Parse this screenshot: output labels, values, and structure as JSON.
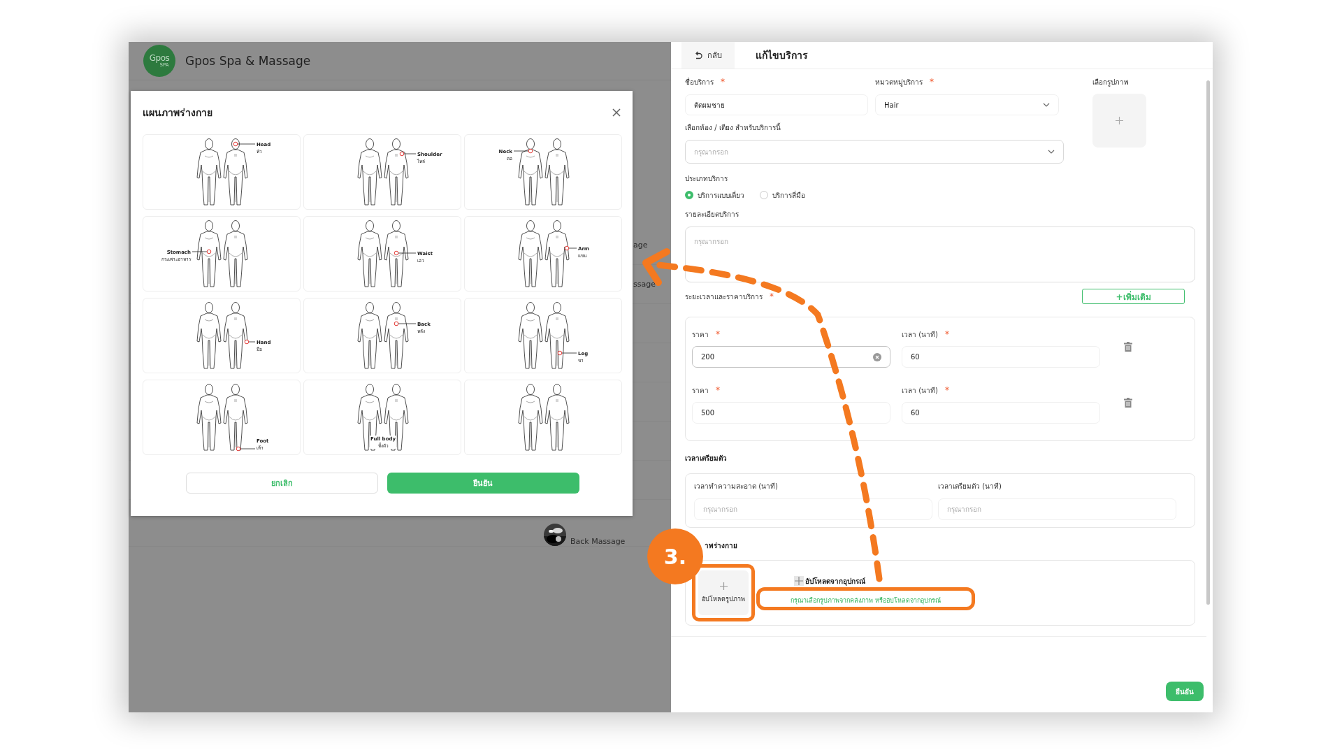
{
  "app": {
    "logo": {
      "text": "Gpos",
      "subtext": "SPA"
    },
    "title": "Gpos Spa & Massage",
    "list_items": [
      {
        "text": "age",
        "kind": "plain"
      },
      {
        "text": "ssage",
        "kind": "plain"
      },
      {
        "kind": "empty"
      },
      {
        "kind": "empty"
      },
      {
        "kind": "empty"
      },
      {
        "kind": "empty"
      },
      {
        "kind": "empty"
      },
      {
        "text": "Back Massage",
        "kind": "picture"
      }
    ]
  },
  "body_map_dialog": {
    "title": "แผนภาพร่างกาย",
    "cards": [
      {
        "kind": "head",
        "label": "Head",
        "label_th": "หัว"
      },
      {
        "kind": "shoulder",
        "label": "Shoulder",
        "label_th": "ไหล่"
      },
      {
        "kind": "neck",
        "label": "Neck",
        "label_th": "คอ"
      },
      {
        "kind": "stomach",
        "label": "Stomach",
        "label_th": "กระเพาะอาหาร"
      },
      {
        "kind": "waist",
        "label": "Waist",
        "label_th": "เอว"
      },
      {
        "kind": "arm",
        "label": "Arm",
        "label_th": "แขน"
      },
      {
        "kind": "hand",
        "label": "Hand",
        "label_th": "มือ"
      },
      {
        "kind": "back",
        "label": "Back",
        "label_th": "หลัง"
      },
      {
        "kind": "leg",
        "label": "Leg",
        "label_th": "ขา"
      },
      {
        "kind": "foot",
        "label": "Foot",
        "label_th": "เท้า"
      },
      {
        "kind": "full",
        "label": "Full body",
        "label_th": "ทั้งตัว"
      },
      {
        "kind": "none"
      }
    ],
    "cancel_button": "ยกเลิก",
    "confirm_button": "ยืนยัน"
  },
  "edit_panel": {
    "back_button": "กลับ",
    "title": "แก้ไขบริการ",
    "service_name": {
      "label": "ชื่อบริการ",
      "required_mark": "*",
      "value": "ตัดผมชาย"
    },
    "category": {
      "label": "หมวดหมู่บริการ",
      "required_mark": "*",
      "value": "Hair"
    },
    "image_picker": {
      "label": "เลือกรูปภาพ"
    },
    "room": {
      "label": "เลือกห้อง / เตียง สำหรับบริการนี้",
      "placeholder": "กรุณากรอก"
    },
    "service_type": {
      "label": "ประเภทบริการ",
      "options": [
        {
          "label": "บริการแบบเดี่ยว",
          "selected": true
        },
        {
          "label": "บริการสี่มือ",
          "selected": false
        }
      ]
    },
    "details": {
      "label": "รายละเอียดบริการ",
      "placeholder": "กรุณากรอก"
    },
    "pricing": {
      "label": "ระยะเวลาและราคาบริการ",
      "required_mark": "*",
      "add_button": "+เพิ่มเติม",
      "rows": [
        {
          "price_label": "ราคา",
          "price_mark": "*",
          "price": "200",
          "focused": true,
          "duration_label": "เวลา (นาที)",
          "duration_mark": "*",
          "duration": "60"
        },
        {
          "price_label": "ราคา",
          "price_mark": "*",
          "price": "500",
          "focused": false,
          "duration_label": "เวลา (นาที)",
          "duration_mark": "*",
          "duration": "60"
        }
      ]
    },
    "prep": {
      "label": "เวลาเตรียมตัว",
      "fields": [
        {
          "label": "เวลาทำความสะอาด (นาที)",
          "placeholder": "กรุณากรอก"
        },
        {
          "label": "เวลาเตรียมตัว (นาที)",
          "placeholder": "กรุณากรอก"
        }
      ]
    },
    "body_image": {
      "label": "าพร่างกาย",
      "upload_tile": "อัปโหลดรูปภาพ",
      "upload_link": "อัปโหลดจากอุปกรณ์",
      "hint": "กรุณาเลือกรูปภาพจากคลังภาพ หรืออัปโหลดจากอุปกรณ์",
      "highlighted": true
    },
    "confirm_button": "ยืนยัน"
  },
  "annotation": {
    "step": "3."
  }
}
